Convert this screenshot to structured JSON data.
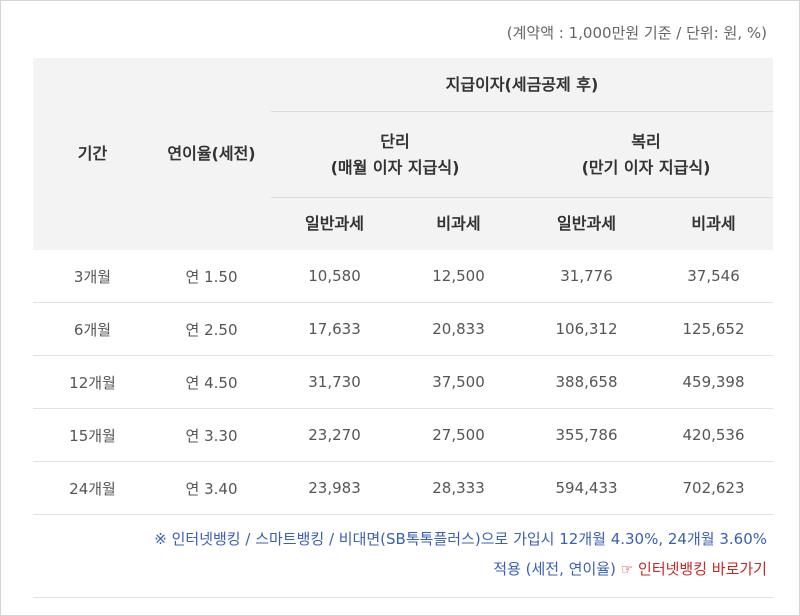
{
  "note": "(계약액 : 1,000만원 기준 / 단위: 원, %)",
  "header": {
    "period": "기간",
    "rate": "연이율(세전)",
    "group": "지급이자(세금공제 후)",
    "simple": "단리",
    "simple_sub": "(매월 이자 지급식)",
    "compound": "복리",
    "compound_sub": "(만기 이자 지급식)",
    "general": "일반과세",
    "taxfree": "비과세"
  },
  "rows": [
    {
      "period": "3개월",
      "rate": "연 1.50",
      "s_general": "10,580",
      "s_taxfree": "12,500",
      "c_general": "31,776",
      "c_taxfree": "37,546"
    },
    {
      "period": "6개월",
      "rate": "연 2.50",
      "s_general": "17,633",
      "s_taxfree": "20,833",
      "c_general": "106,312",
      "c_taxfree": "125,652"
    },
    {
      "period": "12개월",
      "rate": "연 4.50",
      "s_general": "31,730",
      "s_taxfree": "37,500",
      "c_general": "388,658",
      "c_taxfree": "459,398"
    },
    {
      "period": "15개월",
      "rate": "연 3.30",
      "s_general": "23,270",
      "s_taxfree": "27,500",
      "c_general": "355,786",
      "c_taxfree": "420,536"
    },
    {
      "period": "24개월",
      "rate": "연 3.40",
      "s_general": "23,983",
      "s_taxfree": "28,333",
      "c_general": "594,433",
      "c_taxfree": "702,623"
    }
  ],
  "notice": {
    "line1": "※ 인터넷뱅킹 / 스마트뱅킹 / 비대면(SB톡톡플러스)으로 가입시 12개월 4.30%, 24개월 3.60%",
    "line2": "적용 (세전, 연이율)",
    "hand": "☞",
    "link": "인터넷뱅킹 바로가기"
  },
  "colors": {
    "header_bg": "#f3f3f3",
    "notice": "#3a5fb8",
    "link": "#c62828"
  },
  "icons": {
    "link_pointer": "pointing-hand-icon"
  }
}
